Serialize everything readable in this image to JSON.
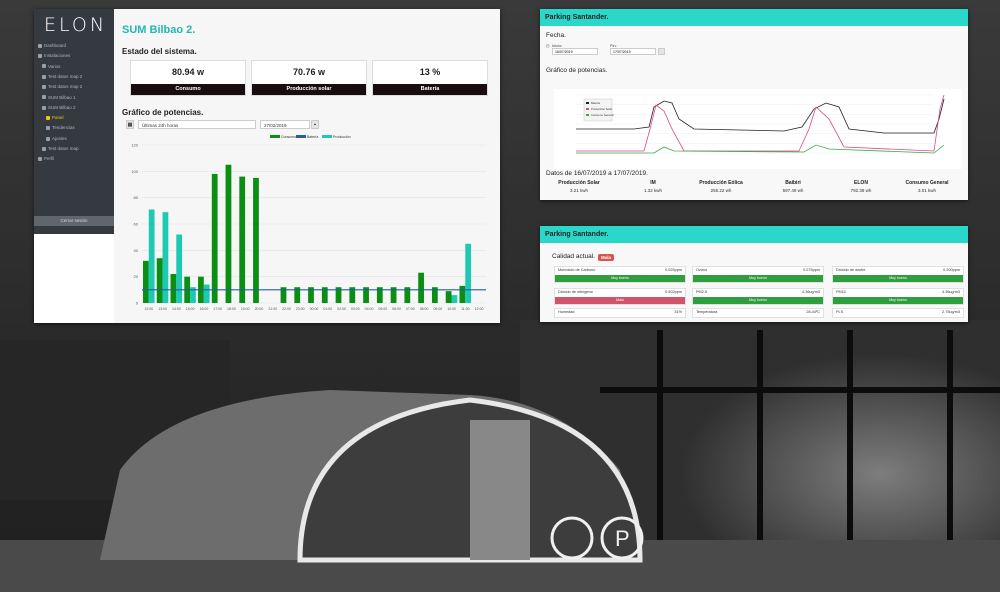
{
  "dashboard": {
    "logo": "ELON",
    "sidebar": [
      {
        "label": "Dashboard",
        "active": false
      },
      {
        "label": "Instalaciones",
        "active": false
      },
      {
        "label": "Varios",
        "active": false
      },
      {
        "label": "Test datos map 2",
        "active": false
      },
      {
        "label": "Test datos map 2",
        "active": false
      },
      {
        "label": "SUM Bilbao 1",
        "active": false
      },
      {
        "label": "SUM Bilbao 2",
        "active": false
      },
      {
        "label": "Panel",
        "active": true
      },
      {
        "label": "Tendencias",
        "active": false
      },
      {
        "label": "Ajustes",
        "active": false
      },
      {
        "label": "Test datos map",
        "active": false
      },
      {
        "label": "Perfil",
        "active": false
      }
    ],
    "close_session": "Cerrar sesión",
    "title": "SUM Bilbao 2.",
    "system_state_title": "Estado del sistema.",
    "stats": [
      {
        "value": "80.94 w",
        "label": "Consumo"
      },
      {
        "value": "70.76 w",
        "label": "Producción solar"
      },
      {
        "value": "13 %",
        "label": "Batería"
      }
    ],
    "power_chart_title": "Gráfico de potencias.",
    "range_select": "Últimas 24h horas",
    "date_value": "27/02/2019",
    "colors": {
      "consumo": "#0a8f13",
      "bateria": "#1f5fa6",
      "produccion": "#1ec9b3",
      "accent": "#21b8b3"
    }
  },
  "chart_data": [
    {
      "type": "bar",
      "legend": [
        "Consumo",
        "Batería",
        "Producción"
      ],
      "categories": [
        "12:00",
        "13:00",
        "14:00",
        "15:00",
        "16:00",
        "17:00",
        "18:00",
        "19:00",
        "20:00",
        "21:00",
        "22:00",
        "23:00",
        "00:00",
        "01:00",
        "02:00",
        "03:00",
        "04:00",
        "05:00",
        "06:00",
        "07:00",
        "08:00",
        "09:00",
        "10:00",
        "11:00",
        "12:00"
      ],
      "series": [
        {
          "name": "Consumo",
          "values": [
            32,
            34,
            22,
            20,
            20,
            98,
            105,
            96,
            95,
            0,
            12,
            12,
            12,
            12,
            12,
            12,
            12,
            12,
            12,
            12,
            23,
            12,
            9,
            13,
            0
          ]
        },
        {
          "name": "Producción",
          "values": [
            71,
            69,
            52,
            12,
            14,
            0,
            0,
            0,
            0,
            0,
            0,
            0,
            0,
            0,
            0,
            0,
            0,
            0,
            0,
            0,
            0,
            0,
            6,
            45,
            0
          ]
        }
      ],
      "battery_line": 10,
      "ylim": [
        0,
        120
      ],
      "yticks": [
        0,
        20,
        40,
        60,
        80,
        100,
        120
      ]
    },
    {
      "type": "line",
      "title": "Gráfico de potencias.",
      "legend_position": "top-left",
      "series": [
        {
          "name": "Batería",
          "color": "#222222"
        },
        {
          "name": "Producción Solar",
          "color": "#d64a8e"
        },
        {
          "name": "Consumo General",
          "color": "#3aa84a"
        }
      ]
    }
  ],
  "parking": {
    "title": "Parking Santander.",
    "fecha_label": "Fecha.",
    "inicio_label": "Inicio:",
    "inicio_value": "16/07/2019",
    "fin_label": "Fin:",
    "fin_value": "17/07/2019",
    "chart_title": "Gráfico de potencias.",
    "range_text": "Datos de 16/07/2019 a 17/07/2019.",
    "summary": [
      {
        "label": "Producción Solar",
        "value": "3.21 kwh"
      },
      {
        "label": "IM",
        "value": "1.32 kwh"
      },
      {
        "label": "Producción Eólica",
        "value": "255.22 wh"
      },
      {
        "label": "Baibiri",
        "value": "597.49 wh"
      },
      {
        "label": "ELON",
        "value": "792.38 wh"
      },
      {
        "label": "Consumo General",
        "value": "3.01 kwh"
      }
    ]
  },
  "air": {
    "title": "Parking Santander.",
    "current_quality": "Calidad actual.",
    "badge": "Mala",
    "cards": [
      {
        "name": "Monóxido de Carbono",
        "value": "0.025ppm",
        "status": "Muy bueno",
        "color": "#2e9e3e"
      },
      {
        "name": "Ozono",
        "value": "0.075ppm",
        "status": "Muy bueno",
        "color": "#2e9e3e"
      },
      {
        "name": "Dióxido de azufre",
        "value": "0.200ppm",
        "status": "Muy bueno",
        "color": "#2e9e3e"
      },
      {
        "name": "Dióxido de nitrógeno",
        "value": "0.502ppm",
        "status": "Malo",
        "color": "#d0546a"
      },
      {
        "name": "PM2.5",
        "value": "4.36ug/m3",
        "status": "Muy bueno",
        "color": "#2e9e3e"
      },
      {
        "name": "PM10",
        "value": "4.36ug/m3",
        "status": "Muy bueno",
        "color": "#2e9e3e"
      },
      {
        "name": "Humedad",
        "value": "31%",
        "status": "",
        "color": ""
      },
      {
        "name": "Temperatura",
        "value": "28.44ºC",
        "status": "",
        "color": ""
      },
      {
        "name": "PLS",
        "value": "2.75ug/m3",
        "status": "",
        "color": ""
      }
    ]
  }
}
